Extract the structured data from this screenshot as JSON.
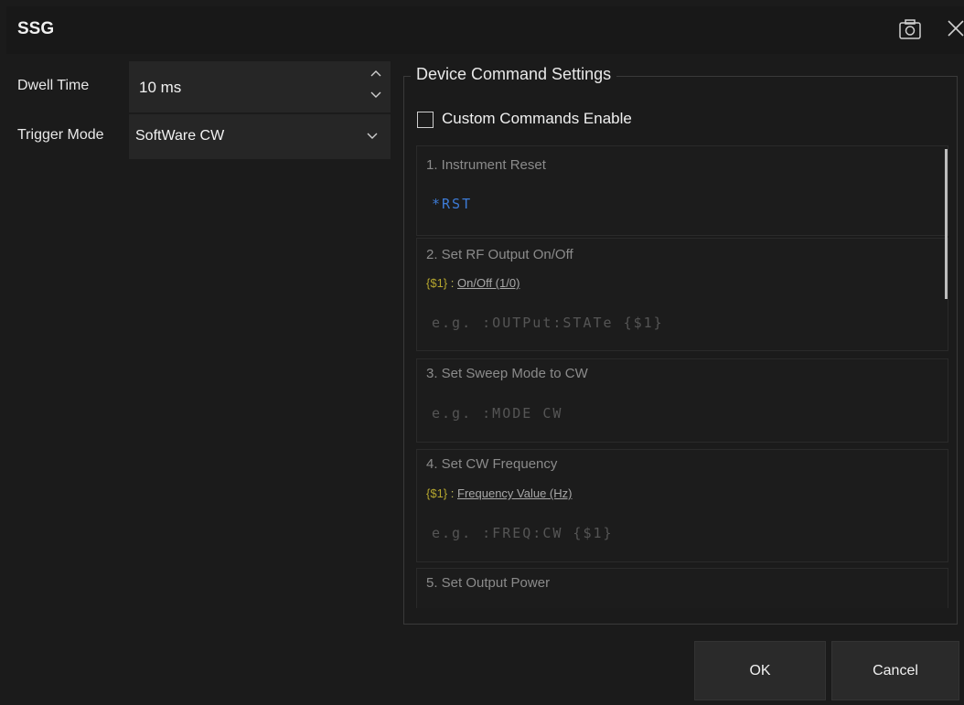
{
  "window": {
    "title": "SSG"
  },
  "left": {
    "dwell": {
      "label": "Dwell Time",
      "value": "10 ms"
    },
    "trigger": {
      "label": "Trigger Mode",
      "value": "SoftWare CW"
    }
  },
  "device": {
    "legend": "Device Command Settings",
    "custom_label": "Custom Commands Enable",
    "custom_checked": false,
    "items": [
      {
        "title": "1. Instrument Reset",
        "command": "*RST"
      },
      {
        "title": "2. Set RF Output On/Off",
        "param_name": "{$1}",
        "param_sep": " : ",
        "param_desc": "On/Off (1/0)",
        "placeholder": "e.g. :OUTPut:STATe {$1}"
      },
      {
        "title": "3. Set Sweep Mode to CW",
        "placeholder": "e.g. :MODE CW"
      },
      {
        "title": "4. Set CW Frequency",
        "param_name": "{$1}",
        "param_sep": " : ",
        "param_desc": "Frequency Value (Hz)",
        "placeholder": "e.g. :FREQ:CW {$1}"
      },
      {
        "title": "5. Set Output Power"
      }
    ]
  },
  "buttons": {
    "ok": "OK",
    "cancel": "Cancel"
  }
}
